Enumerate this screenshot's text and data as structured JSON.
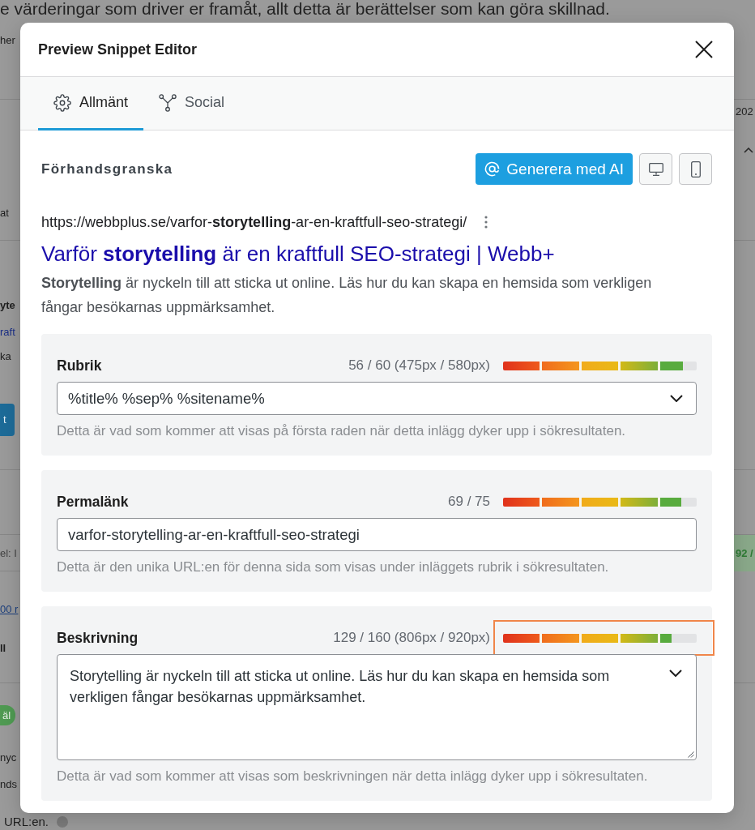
{
  "background": {
    "top_text": "e värderingar som driver er framåt, allt detta är berättelser som kan göra skillnad.",
    "left": [
      {
        "kind": "text",
        "text": "her"
      },
      {
        "kind": "text",
        "text": "at"
      },
      {
        "kind": "strong",
        "text": "yte"
      },
      {
        "kind": "link",
        "text": "raft"
      },
      {
        "kind": "text",
        "text": "ka"
      },
      {
        "kind": "button",
        "text": "t"
      },
      {
        "kind": "muted",
        "text": "el: I"
      },
      {
        "kind": "underline_link",
        "text": "00 r"
      },
      {
        "kind": "strong",
        "text": "ll"
      },
      {
        "kind": "badge",
        "text": "äl"
      },
      {
        "kind": "text",
        "text": "nyc"
      },
      {
        "kind": "text",
        "text": "nds"
      },
      {
        "kind": "help",
        "text": "URL:en."
      }
    ],
    "right": [
      {
        "kind": "text",
        "text": "202"
      },
      {
        "kind": "caret"
      },
      {
        "kind": "band",
        "text": "92 /"
      }
    ]
  },
  "dialog": {
    "title": "Preview Snippet Editor"
  },
  "tabs": [
    {
      "label": "Allmänt",
      "selected": true
    },
    {
      "label": "Social",
      "selected": false
    }
  ],
  "preview": {
    "heading": "Förhandsgranska",
    "ai_button": "Generera med AI"
  },
  "snippet": {
    "url": "https://webbplus.se/varfor-**storytelling**-ar-en-kraftfull-seo-strategi/",
    "title": "Varför **storytelling** är en kraftfull SEO-strategi | Webb+",
    "description": "**Storytelling** är nyckeln till att sticka ut online. Läs hur du kan skapa en hemsida som verkligen fångar besökarnas uppmärksamhet."
  },
  "fields": [
    {
      "kind": "select",
      "label": "Rubrik",
      "counter": "56 / 60 (475px / 580px)",
      "level": 0.93,
      "highlighted": false,
      "value": "%title% %sep% %sitename%",
      "help": "Detta är vad som kommer att visas på första raden när detta inlägg dyker upp i sökresultaten."
    },
    {
      "kind": "text",
      "label": "Permalänk",
      "counter": "69 / 75",
      "level": 0.92,
      "highlighted": false,
      "value": "varfor-storytelling-ar-en-kraftfull-seo-strategi",
      "help": "Detta är den unika URL:en för denna sida som visas under inläggets rubrik i sökresultaten."
    },
    {
      "kind": "textarea",
      "label": "Beskrivning",
      "counter": "129 / 160 (806px / 920px)",
      "level": 0.87,
      "highlighted": true,
      "value": "Storytelling är nyckeln till att sticka ut online. Läs hur du kan skapa en hemsida som verkligen fångar besökarnas uppmärksamhet.",
      "help": "Detta är vad som kommer att visas som beskrivningen när detta inlägg dyker upp i sökresultaten."
    }
  ]
}
